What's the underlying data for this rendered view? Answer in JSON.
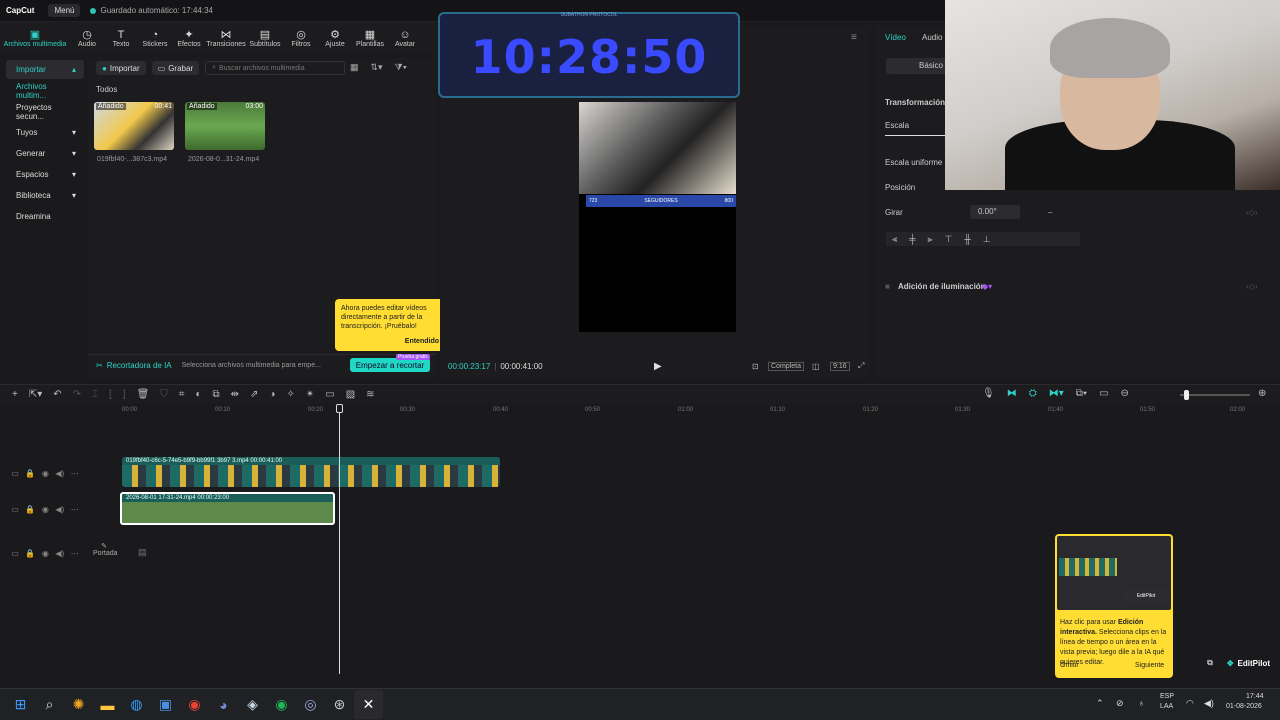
{
  "titlebar": {
    "app_name": "CapCut",
    "menu_label": "Menú",
    "autosave_text": "Guardado automático: 17:44:34"
  },
  "toolbar": {
    "tools": [
      {
        "label": "Archivos multimedia",
        "icon": "media-icon"
      },
      {
        "label": "Audio",
        "icon": "audio-icon"
      },
      {
        "label": "Texto",
        "icon": "text-icon"
      },
      {
        "label": "Stickers",
        "icon": "sticker-icon"
      },
      {
        "label": "Efectos",
        "icon": "effects-icon"
      },
      {
        "label": "Transiciones",
        "icon": "transitions-icon"
      },
      {
        "label": "Subtítulos",
        "icon": "subtitles-icon"
      },
      {
        "label": "Filtros",
        "icon": "filters-icon"
      },
      {
        "label": "Ajuste",
        "icon": "adjust-icon"
      },
      {
        "label": "Plantillas",
        "icon": "templates-icon"
      },
      {
        "label": "Avatar",
        "icon": "avatar-icon"
      }
    ]
  },
  "leftnav": {
    "items": [
      "Importar",
      "Archivos multim...",
      "Proyectos secun...",
      "Tuyos",
      "Generar",
      "Espacios",
      "Biblioteca",
      "Dreamina"
    ]
  },
  "media": {
    "import_label": "Importar",
    "record_label": "Grabar",
    "search_placeholder": "Buscar archivos multimedia",
    "filter_all": "Todos",
    "items": [
      {
        "tag": "Añadido",
        "duration": "00:41",
        "name": "019fbf40-...387c3.mp4"
      },
      {
        "tag": "Añadido",
        "duration": "03:00",
        "name": "2026-08-0...31-24.mp4"
      }
    ]
  },
  "ai_bar": {
    "title": "Recortadora de IA",
    "hint": "Selecciona archivos multimedia para empe...",
    "start_label": "Empezar a recortar",
    "badge": "Prueba gratis"
  },
  "tooltip": {
    "text": "Ahora puedes editar vídeos directamente a partir de la transcripción. ¡Pruébalo!",
    "ok_label": "Entendido"
  },
  "player": {
    "timer_header": "SUBATHON PROTOCOL",
    "timer_value": "10:28:50",
    "current_time": "00:00:23:17",
    "total_time": "00:00:41:00",
    "subscriber_left": "723",
    "subscriber_label": "SEGUIDORES",
    "subscriber_right": "800",
    "full_label": "Completa",
    "ratio_label": "9:16"
  },
  "rightpanel": {
    "tab_video": "Vídeo",
    "tab_audio": "Audio",
    "basic_label": "Básico",
    "transform_label": "Transformación",
    "scale_label": "Escala",
    "uniform_scale_label": "Escala uniforme",
    "position_label": "Posición",
    "rotate_label": "Girar",
    "rotate_value": "0.00°",
    "lighting_label": "Adición de iluminación"
  },
  "ruler": {
    "ticks": [
      "00:00",
      "00:10",
      "00:20",
      "00:30",
      "00:40",
      "00:50",
      "01:00",
      "01:10",
      "01:20",
      "01:30",
      "01:40",
      "01:50",
      "02:00"
    ]
  },
  "timeline": {
    "clip1_label": "019fbf40-c6c-5-74e5-b9f9-bb99f1 3b97 3.mp4   00:00:41:00",
    "clip2_label": "2026-08-01 17-31-24.mp4   00:00:23:00",
    "cover_label": "Portada"
  },
  "help": {
    "text_pre": "Haz clic para usar ",
    "text_bold": "Edición interactiva.",
    "text_post": " Selecciona clips en la línea de tiempo o un área en la vista previa; luego dile a la IA qué quieres editar.",
    "omit_label": "Omitir",
    "next_label": "Siguiente",
    "mini_button": "EditPilot"
  },
  "editpilot": {
    "label": "EditPilot"
  },
  "taskbar": {
    "lang": "ESP",
    "lang_sub": "LAA",
    "time": "17:44",
    "date": "01-08-2026"
  },
  "colors": {
    "accent": "#2ed3c6",
    "tooltip": "#ffdd33",
    "timer": "#3a4aff"
  }
}
